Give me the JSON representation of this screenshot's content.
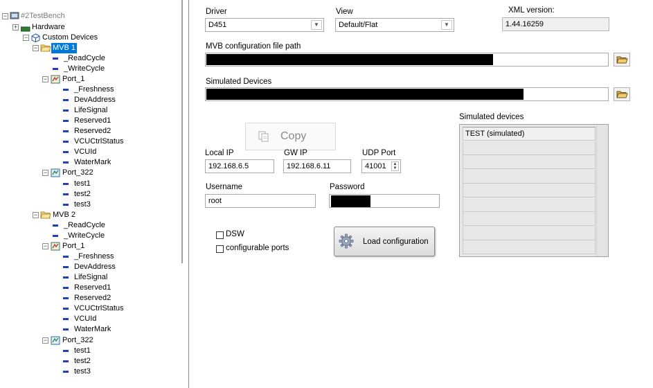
{
  "tree": {
    "root": "#2TestBench",
    "hardware": "Hardware",
    "custom_devices": "Custom Devices",
    "mvb1": {
      "label": "MVB 1",
      "read": "_ReadCycle",
      "write": "_WriteCycle",
      "port1": {
        "label": "Port_1",
        "items": [
          "_Freshness",
          "DevAddress",
          "LifeSignal",
          "Reserved1",
          "Reserved2",
          "VCUCtrlStatus",
          "VCUId",
          "WaterMark"
        ]
      },
      "port322": {
        "label": "Port_322",
        "items": [
          "test1",
          "test2",
          "test3"
        ]
      }
    },
    "mvb2": {
      "label": "MVB 2",
      "read": "_ReadCycle",
      "write": "_WriteCycle",
      "port1": {
        "label": "Port_1",
        "items": [
          "_Freshness",
          "DevAddress",
          "LifeSignal",
          "Reserved1",
          "Reserved2",
          "VCUCtrlStatus",
          "VCUId",
          "WaterMark"
        ]
      },
      "port322": {
        "label": "Port_322",
        "items": [
          "test1",
          "test2",
          "test3"
        ]
      }
    }
  },
  "config": {
    "driver_label": "Driver",
    "driver_value": "D451",
    "view_label": "View",
    "view_value": "Default/Flat",
    "xml_label": "XML version:",
    "xml_value": "1.44.16259",
    "mvb_path_label": "MVB configuration file path",
    "sim_devices_label": "Simulated Devices",
    "copy_label": "Copy",
    "local_ip_label": "Local IP",
    "local_ip_value": "192.168.6.5",
    "gw_ip_label": "GW IP",
    "gw_ip_value": "192.168.6.11",
    "udp_label": "UDP Port",
    "udp_value": "41001",
    "username_label": "Username",
    "username_value": "root",
    "password_label": "Password",
    "dsw_label": "DSW",
    "conf_ports_label": "configurable ports",
    "load_button": "Load configuration",
    "sim_list_label": "Simulated devices",
    "sim_list_items": [
      "TEST (simulated)"
    ]
  },
  "colors": {
    "selection": "#0078d7",
    "leaf_dash": "#1f3fbf",
    "folder": "#e8b84a",
    "hardware": "#2e7d32"
  }
}
